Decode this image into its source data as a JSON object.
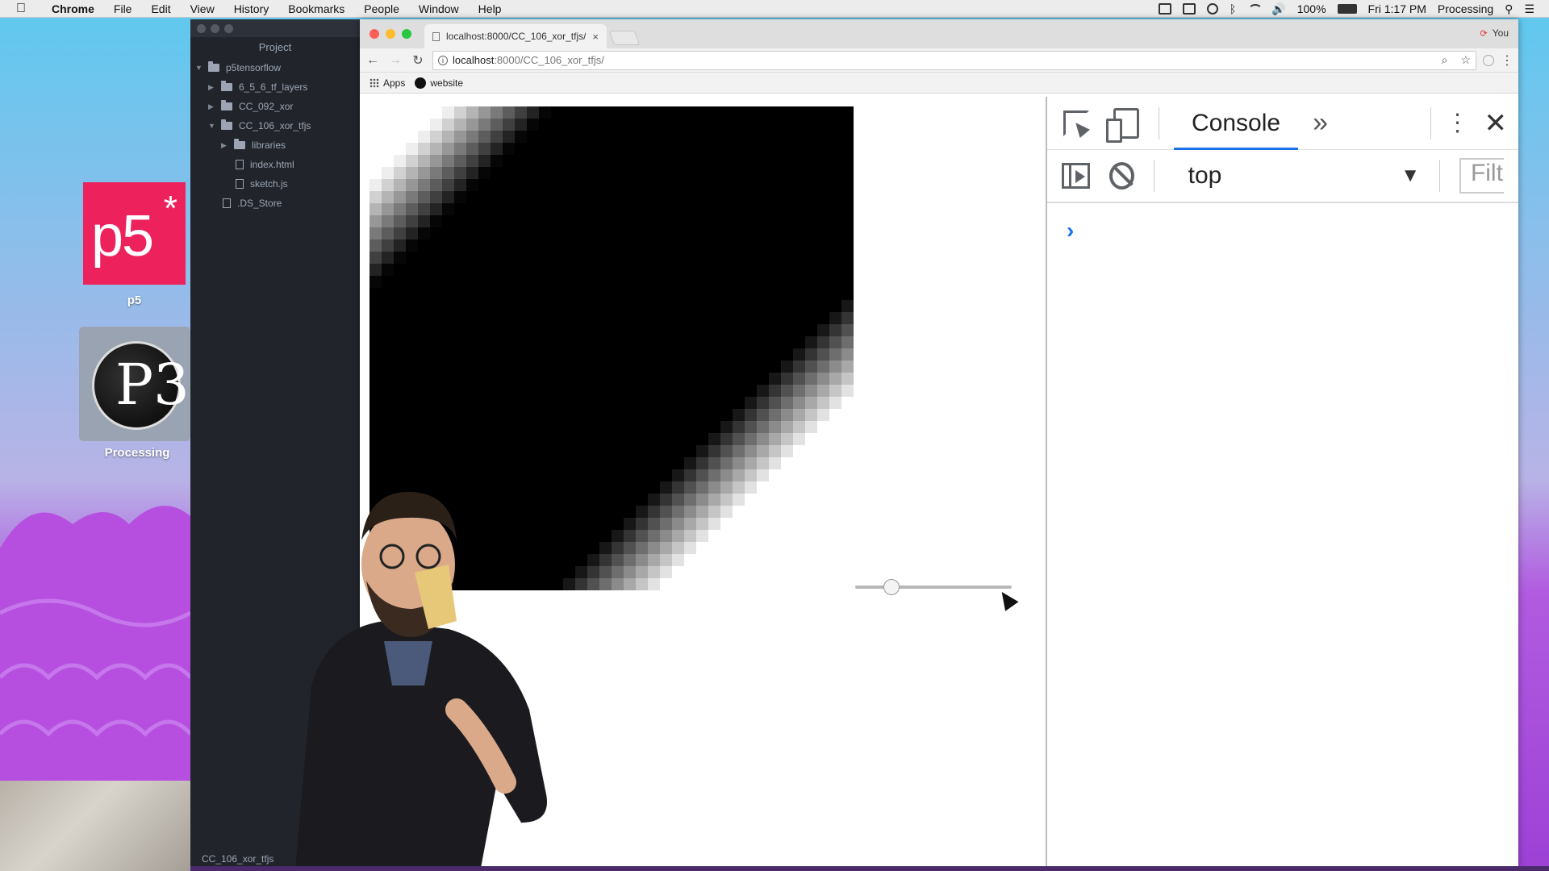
{
  "menubar": {
    "app_name": "Chrome",
    "menus": [
      "File",
      "Edit",
      "View",
      "History",
      "Bookmarks",
      "People",
      "Window",
      "Help"
    ],
    "battery": "100%",
    "clock": "Fri 1:17 PM",
    "active_app": "Processing"
  },
  "desktop": {
    "p5_logo_text": "p5",
    "p5_logo_star": "*",
    "p5_label": "p5",
    "processing_label": "Processing"
  },
  "editor": {
    "panel_title": "Project",
    "tree": [
      {
        "label": "p5tensorflow",
        "type": "folder",
        "expanded": true,
        "depth": 0
      },
      {
        "label": "6_5_6_tf_layers",
        "type": "folder",
        "expanded": false,
        "depth": 1
      },
      {
        "label": "CC_092_xor",
        "type": "folder",
        "expanded": false,
        "depth": 1
      },
      {
        "label": "CC_106_xor_tfjs",
        "type": "folder",
        "expanded": true,
        "depth": 1
      },
      {
        "label": "libraries",
        "type": "folder",
        "expanded": false,
        "depth": 2
      },
      {
        "label": "index.html",
        "type": "file",
        "depth": 2
      },
      {
        "label": "sketch.js",
        "type": "file",
        "depth": 2
      },
      {
        "label": ".DS_Store",
        "type": "file",
        "depth": 1
      }
    ],
    "status_path": "CC_106_xor_tfjs"
  },
  "browser": {
    "tab_title": "localhost:8000/CC_106_xor_tfjs/",
    "tab_close": "×",
    "profile_name": "You",
    "url_host": "localhost",
    "url_path": ":8000/CC_106_xor_tfjs/",
    "bookmarks": [
      {
        "label": "Apps",
        "icon": "apps-grid-icon"
      },
      {
        "label": "website",
        "icon": "github-icon"
      }
    ]
  },
  "sketch": {
    "grid_resolution": 40,
    "slider_value": 0.2
  },
  "devtools": {
    "active_tab": "Console",
    "more_tabs": "»",
    "context": "top",
    "filter_placeholder": "Filter",
    "prompt": "›",
    "close": "✕"
  },
  "colors": {
    "console_accent": "#1a73e8",
    "p5_brand": "#ed225d"
  }
}
